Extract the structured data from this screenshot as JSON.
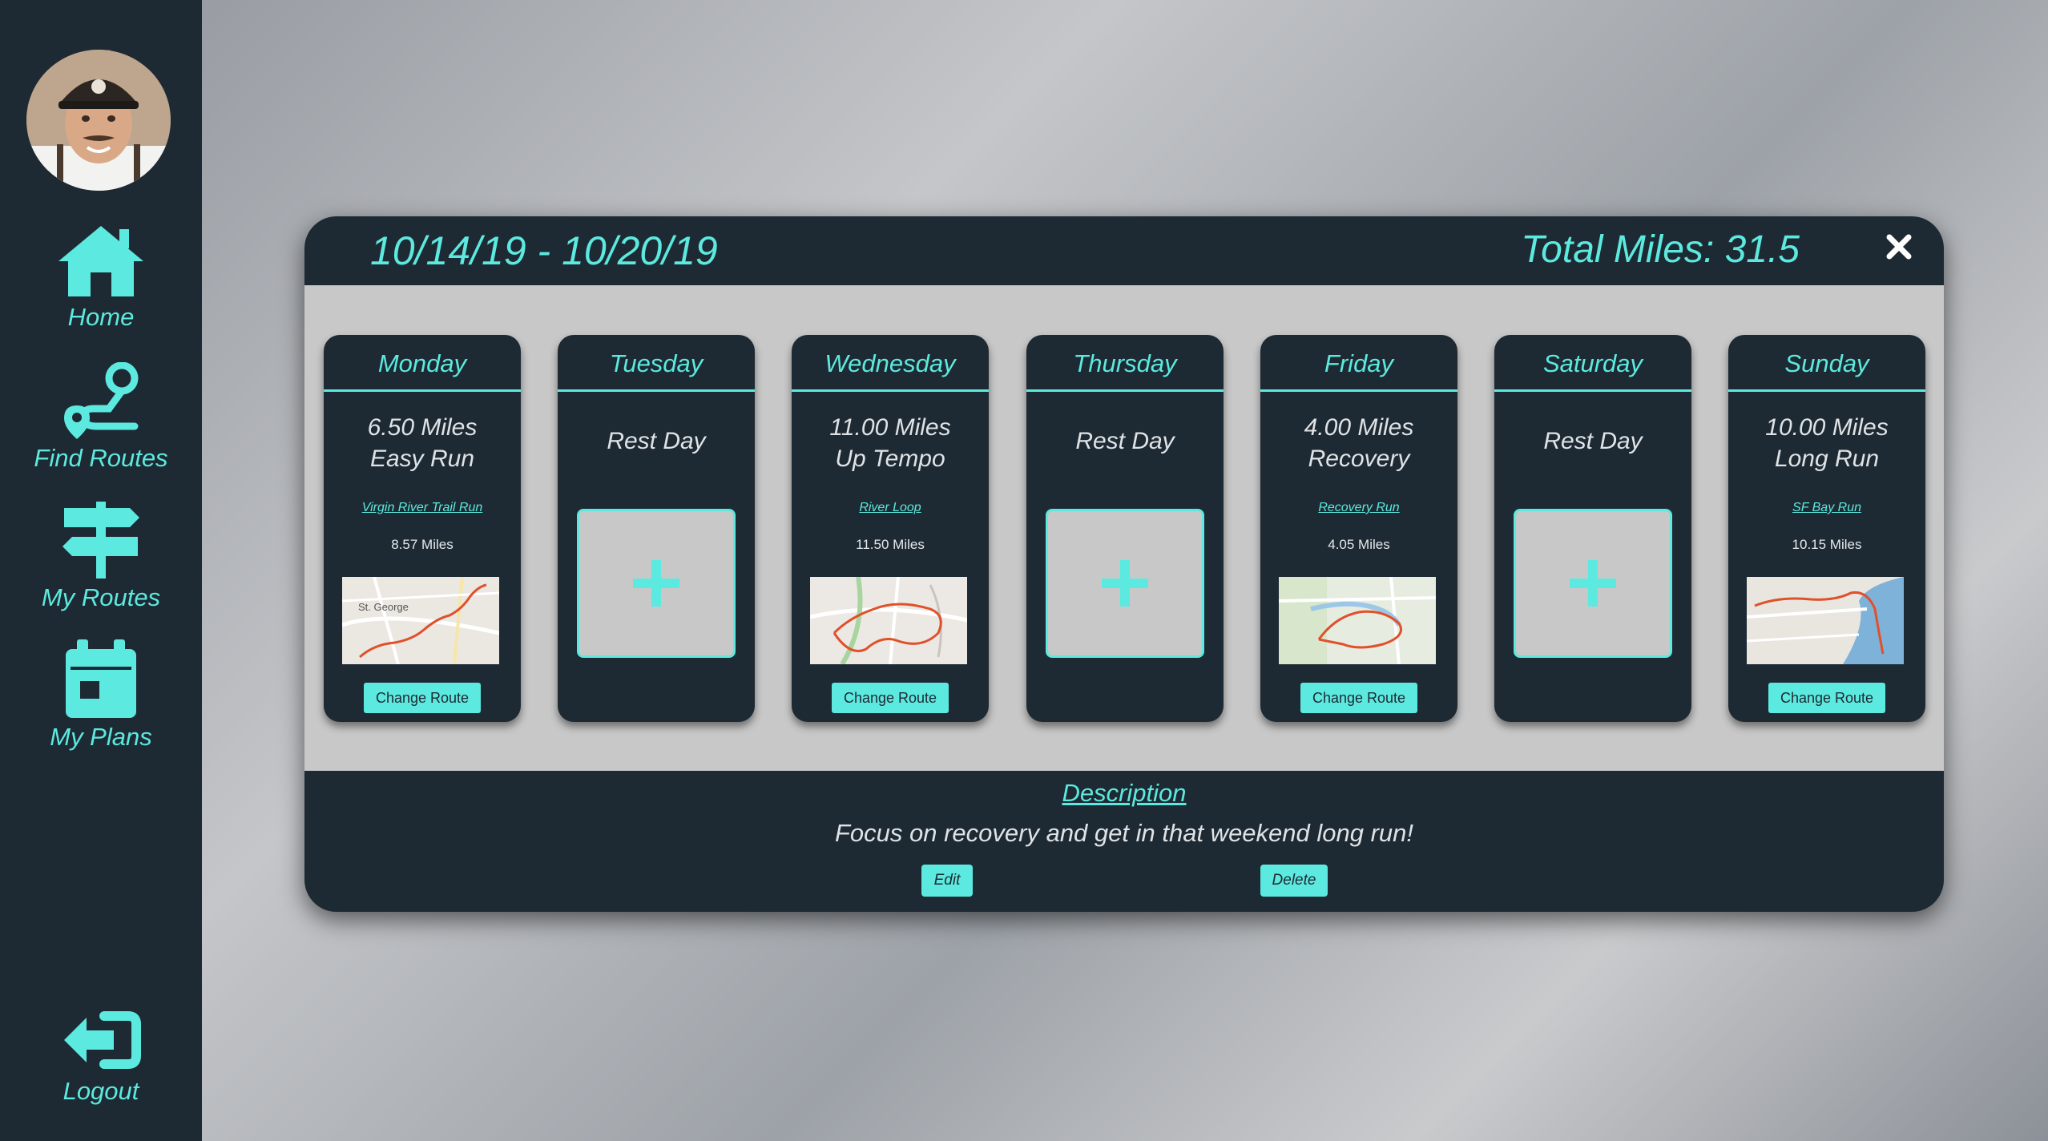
{
  "sidebar": {
    "items": [
      {
        "label": "Home",
        "icon": "home-icon"
      },
      {
        "label": "Find Routes",
        "icon": "route-pin-icon"
      },
      {
        "label": "My Routes",
        "icon": "signpost-icon"
      },
      {
        "label": "My Plans",
        "icon": "calendar-icon"
      }
    ],
    "logout": {
      "label": "Logout",
      "icon": "logout-icon"
    }
  },
  "plan": {
    "date_range": "10/14/19 - 10/20/19",
    "total_label": "Total Miles:",
    "total_value": "31.5",
    "days": [
      {
        "name": "Monday",
        "rest": false,
        "miles": "6.50 Miles",
        "type": "Easy Run",
        "route_name": "Virgin River Trail Run",
        "route_miles": "8.57 Miles",
        "change_label": "Change Route",
        "map_label": "St. George"
      },
      {
        "name": "Tuesday",
        "rest": true,
        "rest_label": "Rest Day"
      },
      {
        "name": "Wednesday",
        "rest": false,
        "miles": "11.00 Miles",
        "type": "Up Tempo",
        "route_name": "River Loop",
        "route_miles": "11.50 Miles",
        "change_label": "Change Route"
      },
      {
        "name": "Thursday",
        "rest": true,
        "rest_label": "Rest Day"
      },
      {
        "name": "Friday",
        "rest": false,
        "miles": "4.00 Miles",
        "type": "Recovery",
        "route_name": "Recovery Run",
        "route_miles": "4.05 Miles",
        "change_label": "Change Route"
      },
      {
        "name": "Saturday",
        "rest": true,
        "rest_label": "Rest Day"
      },
      {
        "name": "Sunday",
        "rest": false,
        "miles": "10.00 Miles",
        "type": "Long Run",
        "route_name": "SF Bay Run",
        "route_miles": "10.15 Miles",
        "change_label": "Change Route"
      }
    ],
    "description_title": "Description",
    "description_text": "Focus on recovery and get in that weekend long run!",
    "edit_label": "Edit",
    "delete_label": "Delete"
  },
  "colors": {
    "accent": "#5ce9df",
    "panel": "#1e2a33",
    "card_area": "#c8c8c8",
    "route_line": "#e0502a"
  }
}
